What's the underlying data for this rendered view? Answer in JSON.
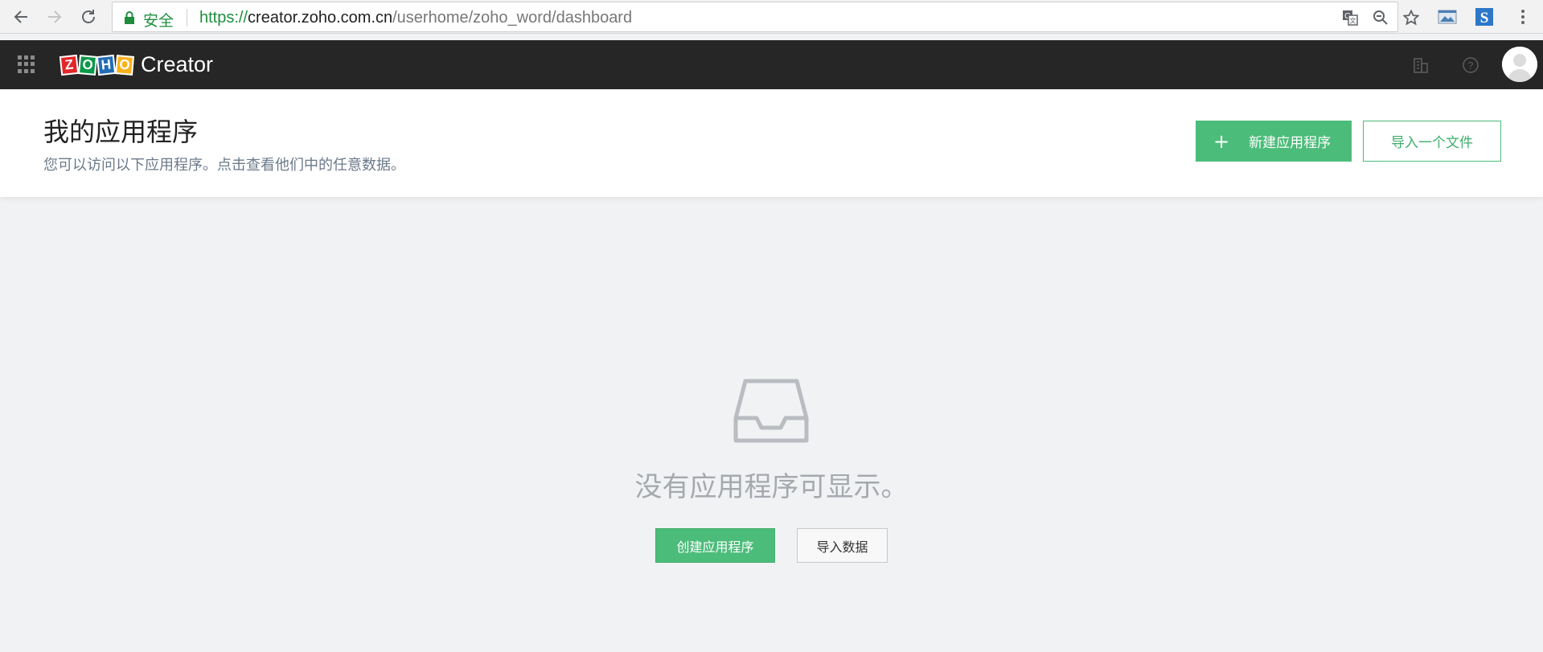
{
  "browser": {
    "secure_label": "安全",
    "url_scheme": "https://",
    "url_host": "creator.zoho.com.cn",
    "url_path": "/userhome/zoho_word/dashboard"
  },
  "header": {
    "logo_letters": [
      "Z",
      "O",
      "H",
      "O"
    ],
    "logo_colors": [
      "#e42527",
      "#089949",
      "#226db4",
      "#f9b21d"
    ],
    "product_name": "Creator"
  },
  "title_panel": {
    "title": "我的应用程序",
    "subtitle": "您可以访问以下应用程序。点击查看他们中的任意数据。",
    "new_app_label": "新建应用程序",
    "new_app_icon": "+",
    "import_file_label": "导入一个文件"
  },
  "empty_state": {
    "icon": "empty-inbox-icon",
    "message": "没有应用程序可显示。",
    "create_label": "创建应用程序",
    "import_label": "导入数据"
  },
  "colors": {
    "accent": "#4cbc7a",
    "header_bg": "#262626",
    "page_bg": "#f1f2f4"
  }
}
